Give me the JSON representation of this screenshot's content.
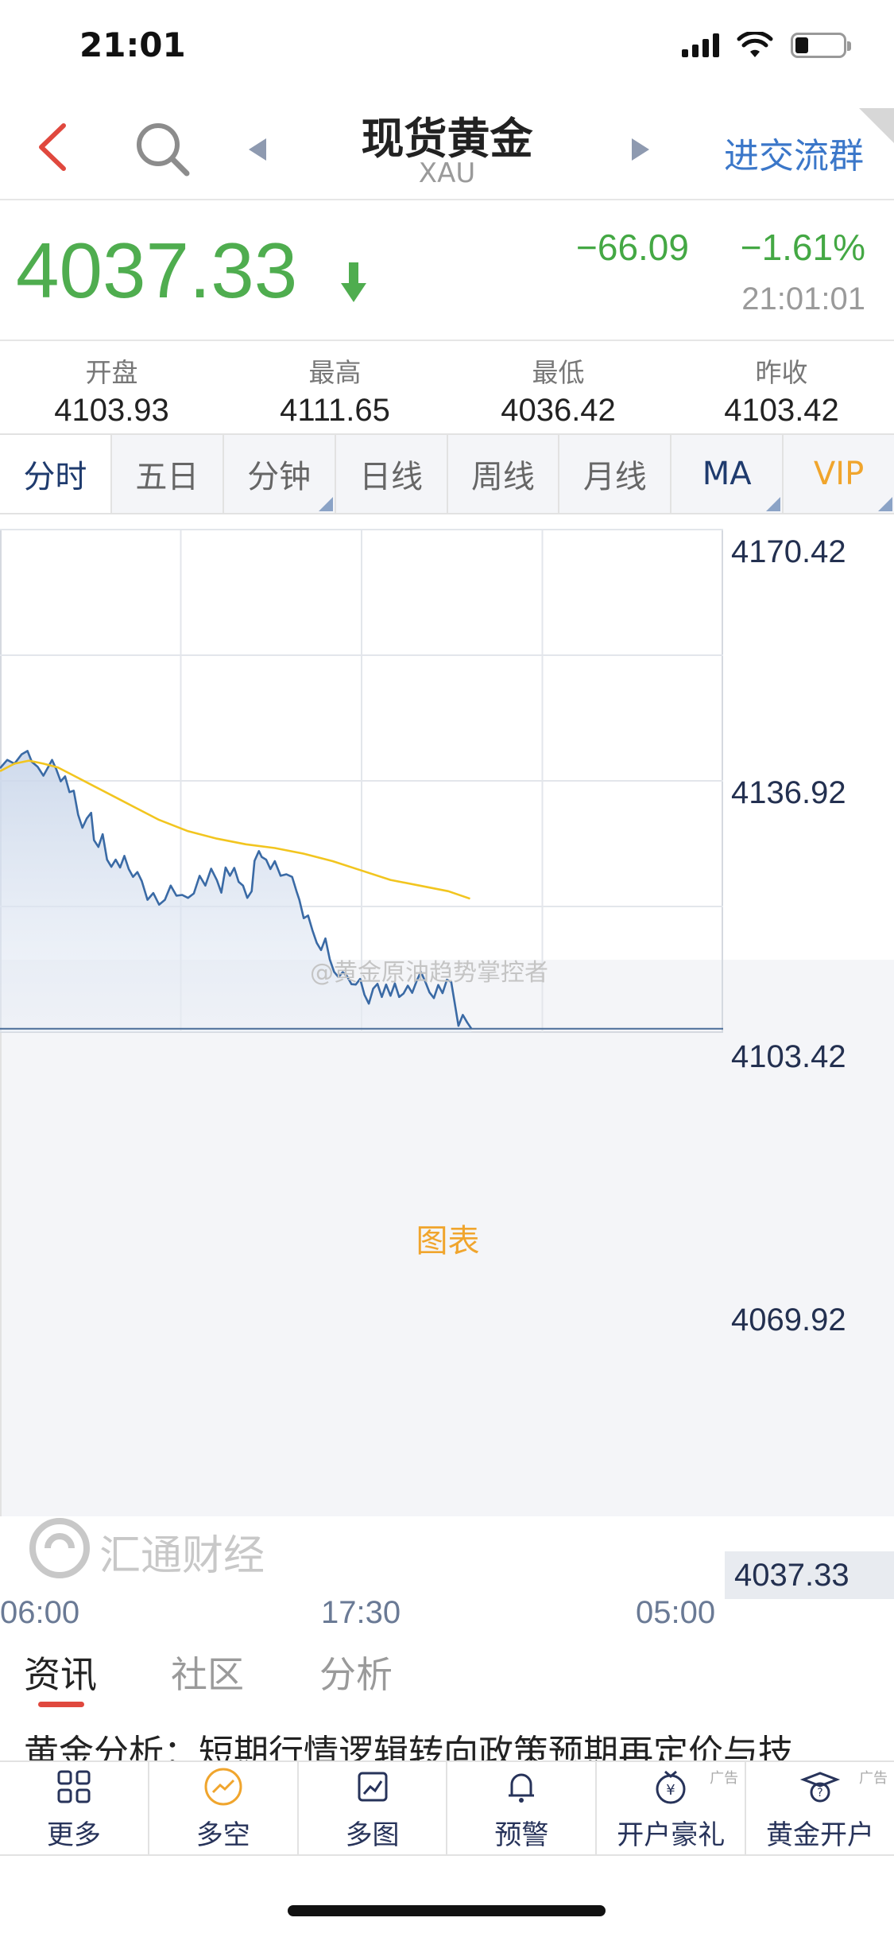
{
  "status": {
    "time": "21:01"
  },
  "nav": {
    "title": "现货黄金",
    "subtitle": "XAU",
    "group_link": "进交流群"
  },
  "quote": {
    "price": "4037.33",
    "change": "−66.09",
    "change_pct": "−1.61%",
    "time": "21:01:01",
    "down_color": "#4fad4f"
  },
  "stats": [
    {
      "label": "开盘",
      "value": "4103.93"
    },
    {
      "label": "最高",
      "value": "4111.65"
    },
    {
      "label": "最低",
      "value": "4036.42"
    },
    {
      "label": "昨收",
      "value": "4103.42"
    }
  ],
  "tabs": [
    "分时",
    "五日",
    "分钟",
    "日线",
    "周线",
    "月线",
    "MA",
    "VIP",
    "图表"
  ],
  "chart_data": {
    "type": "line",
    "x_ticks": [
      "06:00",
      "17:30",
      "05:00"
    ],
    "y_ticks": [
      "4170.42",
      "4136.92",
      "4103.42",
      "4069.92"
    ],
    "current_price_label": "4037.33",
    "ylim": [
      4036.42,
      4170.42
    ],
    "session_fraction_range": [
      0,
      1
    ],
    "series": [
      {
        "kind": "price",
        "color": "#3a6aa5",
        "points": [
          [
            0.0,
            4106.8
          ],
          [
            0.01,
            4109.0
          ],
          [
            0.02,
            4108.0
          ],
          [
            0.03,
            4110.5
          ],
          [
            0.038,
            4111.4
          ],
          [
            0.044,
            4108.5
          ],
          [
            0.052,
            4107.2
          ],
          [
            0.06,
            4104.8
          ],
          [
            0.066,
            4106.9
          ],
          [
            0.072,
            4109.0
          ],
          [
            0.078,
            4106.4
          ],
          [
            0.084,
            4103.3
          ],
          [
            0.09,
            4104.6
          ],
          [
            0.096,
            4100.4
          ],
          [
            0.102,
            4100.8
          ],
          [
            0.108,
            4094.4
          ],
          [
            0.114,
            4090.9
          ],
          [
            0.12,
            4093.4
          ],
          [
            0.126,
            4094.9
          ],
          [
            0.13,
            4087.6
          ],
          [
            0.136,
            4085.8
          ],
          [
            0.142,
            4089.2
          ],
          [
            0.148,
            4082.4
          ],
          [
            0.154,
            4080.5
          ],
          [
            0.16,
            4082.4
          ],
          [
            0.166,
            4080.3
          ],
          [
            0.172,
            4083.4
          ],
          [
            0.178,
            4079.9
          ],
          [
            0.184,
            4077.8
          ],
          [
            0.19,
            4079.1
          ],
          [
            0.196,
            4076.7
          ],
          [
            0.204,
            4071.7
          ],
          [
            0.212,
            4073.5
          ],
          [
            0.22,
            4070.4
          ],
          [
            0.228,
            4071.7
          ],
          [
            0.236,
            4075.5
          ],
          [
            0.244,
            4072.8
          ],
          [
            0.252,
            4073.0
          ],
          [
            0.26,
            4072.2
          ],
          [
            0.268,
            4073.4
          ],
          [
            0.276,
            4078.1
          ],
          [
            0.284,
            4075.5
          ],
          [
            0.292,
            4080.0
          ],
          [
            0.3,
            4076.9
          ],
          [
            0.306,
            4073.6
          ],
          [
            0.312,
            4080.3
          ],
          [
            0.318,
            4078.1
          ],
          [
            0.324,
            4080.2
          ],
          [
            0.33,
            4076.5
          ],
          [
            0.336,
            4075.5
          ],
          [
            0.342,
            4072.2
          ],
          [
            0.348,
            4074.0
          ],
          [
            0.352,
            4082.1
          ],
          [
            0.358,
            4084.7
          ],
          [
            0.362,
            4083.1
          ],
          [
            0.368,
            4082.4
          ],
          [
            0.374,
            4079.9
          ],
          [
            0.38,
            4082.0
          ],
          [
            0.388,
            4078.1
          ],
          [
            0.396,
            4078.5
          ],
          [
            0.404,
            4077.8
          ],
          [
            0.41,
            4074.0
          ],
          [
            0.414,
            4071.7
          ],
          [
            0.42,
            4066.8
          ],
          [
            0.426,
            4067.5
          ],
          [
            0.432,
            4063.6
          ],
          [
            0.438,
            4060.2
          ],
          [
            0.444,
            4058.3
          ],
          [
            0.45,
            4061.4
          ],
          [
            0.456,
            4055.8
          ],
          [
            0.462,
            4052.5
          ],
          [
            0.468,
            4051.1
          ],
          [
            0.474,
            4052.4
          ],
          [
            0.48,
            4051.3
          ],
          [
            0.486,
            4049.2
          ],
          [
            0.492,
            4049.1
          ],
          [
            0.498,
            4050.6
          ],
          [
            0.504,
            4046.4
          ],
          [
            0.51,
            4044.0
          ],
          [
            0.516,
            4048.0
          ],
          [
            0.522,
            4049.3
          ],
          [
            0.528,
            4045.8
          ],
          [
            0.534,
            4049.1
          ],
          [
            0.54,
            4046.1
          ],
          [
            0.546,
            4049.4
          ],
          [
            0.552,
            4045.8
          ],
          [
            0.558,
            4046.7
          ],
          [
            0.564,
            4048.8
          ],
          [
            0.57,
            4046.9
          ],
          [
            0.576,
            4050.0
          ],
          [
            0.582,
            4052.5
          ],
          [
            0.588,
            4049.9
          ],
          [
            0.594,
            4047.0
          ],
          [
            0.6,
            4045.5
          ],
          [
            0.606,
            4049.0
          ],
          [
            0.612,
            4046.8
          ],
          [
            0.618,
            4050.4
          ],
          [
            0.624,
            4049.8
          ],
          [
            0.628,
            4045.1
          ],
          [
            0.634,
            4038.1
          ],
          [
            0.64,
            4041.0
          ],
          [
            0.646,
            4039.0
          ],
          [
            0.652,
            4037.3
          ]
        ]
      },
      {
        "kind": "moving-average",
        "color": "#f2c51f",
        "points": [
          [
            0.0,
            4106.0
          ],
          [
            0.02,
            4108.0
          ],
          [
            0.04,
            4108.8
          ],
          [
            0.06,
            4108.0
          ],
          [
            0.08,
            4107.0
          ],
          [
            0.1,
            4105.0
          ],
          [
            0.13,
            4102.0
          ],
          [
            0.16,
            4099.0
          ],
          [
            0.19,
            4096.0
          ],
          [
            0.22,
            4093.0
          ],
          [
            0.26,
            4090.0
          ],
          [
            0.3,
            4088.0
          ],
          [
            0.34,
            4086.5
          ],
          [
            0.38,
            4085.5
          ],
          [
            0.42,
            4084.0
          ],
          [
            0.46,
            4082.0
          ],
          [
            0.5,
            4079.5
          ],
          [
            0.54,
            4077.0
          ],
          [
            0.58,
            4075.5
          ],
          [
            0.62,
            4074.0
          ],
          [
            0.65,
            4072.0
          ]
        ]
      }
    ]
  },
  "watermark": "@黄金原油趋势掌控者",
  "logo_text": "汇通财经",
  "section_tabs": [
    "资讯",
    "社区",
    "分析"
  ],
  "news_headline": "黄金分析：短期行情逻辑转向政策预期再定价与技",
  "bottom_bar": [
    {
      "label": "更多",
      "icon": "grid-icon",
      "ad": ""
    },
    {
      "label": "多空",
      "icon": "trend-icon",
      "ad": ""
    },
    {
      "label": "多图",
      "icon": "chart-icon",
      "ad": ""
    },
    {
      "label": "预警",
      "icon": "bell-icon",
      "ad": ""
    },
    {
      "label": "开户豪礼",
      "icon": "gift-icon",
      "ad": "广告"
    },
    {
      "label": "黄金开户",
      "icon": "grad-icon",
      "ad": "广告"
    }
  ]
}
